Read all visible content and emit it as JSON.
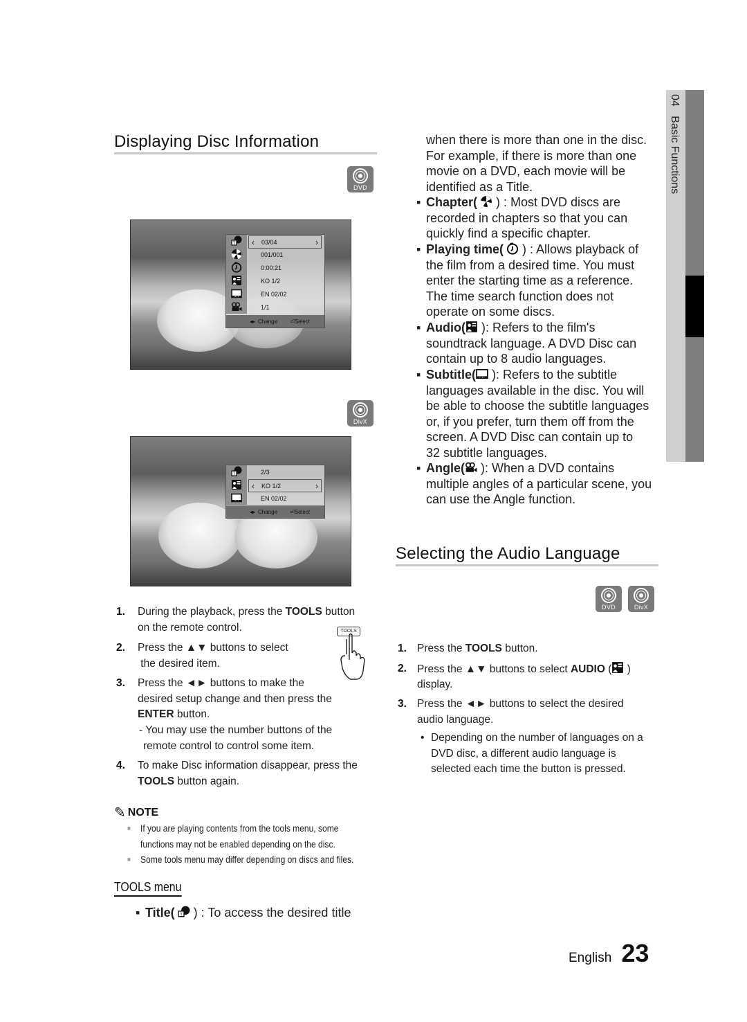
{
  "page": {
    "language": "English",
    "number": "23",
    "side_tab": {
      "chapter": "04",
      "title": "Basic Functions"
    }
  },
  "section1": {
    "title": "Displaying Disc Information",
    "badge1": "DVD",
    "badge2": "DivX",
    "osd_dvd": {
      "rows": [
        "03/04",
        "001/001",
        "0:00:21",
        "KO 1/2",
        "EN 02/02",
        "1/1"
      ],
      "icons": [
        "title-icon",
        "chapter-icon",
        "playing-time-icon",
        "audio-icon",
        "subtitle-icon",
        "angle-icon"
      ],
      "footer_change": "Change",
      "footer_select": "Select"
    },
    "osd_divx": {
      "rows": [
        "2/3",
        "KO 1/2",
        "EN 02/02"
      ],
      "icons": [
        "title-icon",
        "audio-icon",
        "subtitle-icon"
      ],
      "footer_change": "Change",
      "footer_select": "Select"
    },
    "tools_button_label": "TOOLS",
    "steps": [
      {
        "n": "1.",
        "pre": "During the playback, press the ",
        "bold": "TOOLS",
        "post": " button",
        "line2": "on the remote control."
      },
      {
        "n": "2.",
        "line1": "Press the ▲▼ buttons to select",
        "line2": " the desired item."
      },
      {
        "n": "3.",
        "line1": "Press the ◄► buttons to make the",
        "line2": "desired setup change and then press the",
        "bold3": "ENTER",
        "post3": " button.",
        "sub1": "- You may use the number buttons of the",
        "sub2": "remote control to control some item."
      },
      {
        "n": "4.",
        "line1": "To make Disc information disappear, press the",
        "bold2": "TOOLS",
        "post2": " button again."
      }
    ],
    "note": {
      "label": "NOTE",
      "items": [
        "If you are playing contents from the tools menu, some",
        "functions may not be enabled depending on the disc.",
        "Some tools menu may differ depending on discs and files."
      ]
    },
    "tools_menu": {
      "heading": "TOOLS menu",
      "title_item": {
        "label": "Title(",
        "close": " ) : To access the desired title"
      }
    }
  },
  "right_col": {
    "title_cont": [
      "when there is more than one in the disc.",
      "For example, if there is more than one",
      "movie on a DVD, each movie will be",
      "identified as a Title."
    ],
    "chapter": {
      "label": "Chapter(",
      "post": " ) : Most DVD discs are",
      "lines": [
        "recorded in chapters so that you can",
        "quickly find a specific chapter."
      ]
    },
    "playing_time": {
      "label": "Playing time(",
      "post": " ) : Allows playback of",
      "lines": [
        "the film from a desired time. You must",
        "enter the starting time as a reference.",
        "The time search function does not",
        "operate on some discs."
      ]
    },
    "audio": {
      "label": "Audio(",
      "post": " ): Refers to the film's",
      "lines": [
        "soundtrack language. A DVD Disc can",
        "contain up to 8 audio languages."
      ]
    },
    "subtitle": {
      "label": "Subtitle(",
      "post": " ): Refers to the subtitle",
      "lines": [
        "languages available in the disc. You will",
        "be able to choose the subtitle languages",
        "or, if you prefer, turn them off from the",
        "screen. A DVD Disc can contain up to",
        "32 subtitle languages."
      ]
    },
    "angle": {
      "label": "Angle(",
      "post": " ): When a DVD contains",
      "lines": [
        "multiple angles of a particular scene, you",
        "can use the Angle function."
      ]
    }
  },
  "section2": {
    "title": "Selecting the Audio Language",
    "badges": [
      "DVD",
      "DivX"
    ],
    "steps": [
      {
        "n": "1.",
        "pre": "Press the ",
        "bold": "TOOLS",
        "post": " button."
      },
      {
        "n": "2.",
        "pre": "Press the ▲▼ buttons to select ",
        "bold": "AUDIO",
        "post": " (",
        "close": " )",
        "line2": "display."
      },
      {
        "n": "3.",
        "line1": "Press the ◄► buttons to select the desired",
        "line2": "audio language."
      }
    ],
    "bullet_lines": [
      "Depending on the number of languages on a",
      "DVD disc, a different audio language is",
      "selected each time the button is pressed."
    ]
  }
}
